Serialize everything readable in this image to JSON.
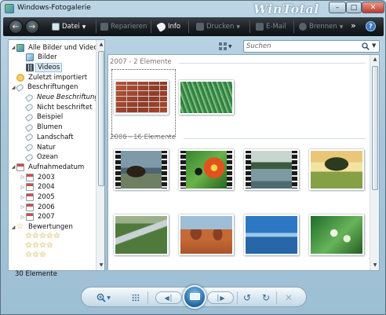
{
  "window": {
    "title": "Windows-Fotogalerie",
    "brand": "WinTotal"
  },
  "toolbar": {
    "file_label": "Datei",
    "repair_label": "Reparieren",
    "info_label": "Info",
    "print_label": "Drucken",
    "email_label": "E-Mail",
    "burn_label": "Brennen",
    "more_label": "»",
    "help_label": "?"
  },
  "search": {
    "placeholder": "Suchen"
  },
  "sidebar": {
    "items": [
      {
        "label": "Alle Bilder und Videos",
        "icon": "library-icon",
        "level": 0,
        "expander": "◢",
        "selected": false
      },
      {
        "label": "Bilder",
        "icon": "pictures-icon",
        "level": 1,
        "expander": "",
        "selected": false
      },
      {
        "label": "Videos",
        "icon": "videos-icon",
        "level": 1,
        "expander": "",
        "selected": true
      },
      {
        "label": "Zuletzt importiert",
        "icon": "recently-imported-icon",
        "level": 0,
        "expander": "",
        "selected": false
      },
      {
        "label": "Beschriftungen",
        "icon": "tag-icon",
        "level": 0,
        "expander": "◢",
        "selected": false
      },
      {
        "label": "Neue Beschriftung e",
        "icon": "tag-icon",
        "level": 1,
        "expander": "",
        "selected": false,
        "italic": true
      },
      {
        "label": "Nicht beschriftet",
        "icon": "tag-icon",
        "level": 1,
        "expander": "",
        "selected": false
      },
      {
        "label": "Beispiel",
        "icon": "tag-icon",
        "level": 1,
        "expander": "",
        "selected": false
      },
      {
        "label": "Blumen",
        "icon": "tag-icon",
        "level": 1,
        "expander": "",
        "selected": false
      },
      {
        "label": "Landschaft",
        "icon": "tag-icon",
        "level": 1,
        "expander": "",
        "selected": false
      },
      {
        "label": "Natur",
        "icon": "tag-icon",
        "level": 1,
        "expander": "",
        "selected": false
      },
      {
        "label": "Ozean",
        "icon": "tag-icon",
        "level": 1,
        "expander": "",
        "selected": false
      },
      {
        "label": "Aufnahmedatum",
        "icon": "calendar-icon",
        "level": 0,
        "expander": "◢",
        "selected": false
      },
      {
        "label": "2003",
        "icon": "calendar-icon",
        "level": 1,
        "expander": "▷",
        "selected": false
      },
      {
        "label": "2004",
        "icon": "calendar-icon",
        "level": 1,
        "expander": "▷",
        "selected": false
      },
      {
        "label": "2005",
        "icon": "calendar-icon",
        "level": 1,
        "expander": "▷",
        "selected": false
      },
      {
        "label": "2006",
        "icon": "calendar-icon",
        "level": 1,
        "expander": "▷",
        "selected": false
      },
      {
        "label": "2007",
        "icon": "calendar-icon",
        "level": 1,
        "expander": "▷",
        "selected": false
      },
      {
        "label": "Bewertungen",
        "icon": "star-icon",
        "level": 0,
        "expander": "◢",
        "selected": false
      }
    ],
    "ratings": [
      5,
      4,
      3
    ]
  },
  "content": {
    "groups": [
      {
        "header": "2007 - 2 Elemente",
        "items": [
          {
            "kind": "photo",
            "subject": "brick-wall",
            "selected": true
          },
          {
            "kind": "photo",
            "subject": "grass"
          }
        ]
      },
      {
        "header": "2006 - 16 Elemente",
        "items": [
          {
            "kind": "video",
            "subject": "bear"
          },
          {
            "kind": "video",
            "subject": "butterfly-flower"
          },
          {
            "kind": "video",
            "subject": "lake"
          },
          {
            "kind": "photo",
            "subject": "tree-sunset"
          },
          {
            "kind": "photo",
            "subject": "creek"
          },
          {
            "kind": "photo",
            "subject": "desert-mesa"
          },
          {
            "kind": "photo",
            "subject": "ocean-pier"
          },
          {
            "kind": "photo",
            "subject": "green-flowers"
          }
        ]
      }
    ]
  },
  "status": {
    "count_text": "30 Elemente"
  },
  "colors": {
    "toolbar": "#1c2126",
    "accent": "#1d5f9a",
    "selection": "#dcebf6"
  }
}
